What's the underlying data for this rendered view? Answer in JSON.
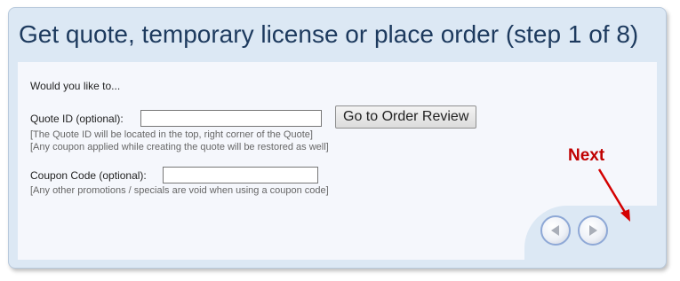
{
  "header": {
    "title": "Get quote, temporary license or place order (step 1 of 8)"
  },
  "form": {
    "intro": "Would you like to...",
    "quote_id": {
      "label": "Quote ID (optional):",
      "value": "",
      "notes": [
        "[The Quote ID will be located in the top, right corner of the Quote]",
        "[Any coupon applied while creating the quote will be restored as well]"
      ]
    },
    "order_review_button": "Go to Order Review",
    "coupon": {
      "label": "Coupon Code (optional):",
      "value": "",
      "note": "[Any other promotions / specials are void when using a coupon code]"
    }
  },
  "navigation": {
    "back_icon": "triangle-left-icon",
    "next_icon": "triangle-right-icon"
  },
  "annotation": {
    "label": "Next",
    "color": "#c00000"
  },
  "colors": {
    "panel_background": "#dce8f4",
    "content_background": "#f5f7fc",
    "title_text": "#1d3a5e",
    "nav_button_border": "#8ea8d6"
  }
}
